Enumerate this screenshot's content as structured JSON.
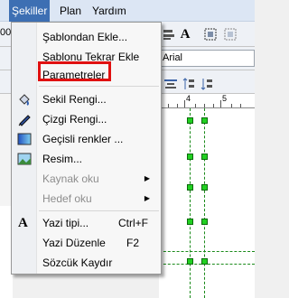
{
  "menubar": {
    "items": [
      {
        "label": "Şekiller",
        "active": true
      },
      {
        "label": "Plan"
      },
      {
        "label": "Yardım"
      }
    ]
  },
  "toolbar": {
    "partial_text": "00",
    "bold_icon": "A"
  },
  "font_box": {
    "value": "Arial"
  },
  "ruler": {
    "numbers": [
      "4",
      "5"
    ]
  },
  "menu": {
    "items": [
      {
        "label": "Şablondan Ekle...",
        "icon": null
      },
      {
        "label": "Şablonu Tekrar Ekle",
        "icon": null
      },
      {
        "label": "Parametreler",
        "icon": null,
        "highlighted": true
      },
      {
        "label": "Sekil Rengi...",
        "icon": "paint-bucket-icon"
      },
      {
        "label": "Çizgi Rengi...",
        "icon": "pen-icon"
      },
      {
        "label": "Geçisli renkler ...",
        "icon": "gradient-icon"
      },
      {
        "label": "Resim...",
        "icon": "picture-icon"
      },
      {
        "label": "Kaynak oku",
        "submenu": true,
        "disabled": true
      },
      {
        "label": "Hedef oku",
        "submenu": true,
        "disabled": true
      },
      {
        "label": "Yazi tipi...",
        "icon": "font-icon",
        "shortcut": "Ctrl+F"
      },
      {
        "label": "Yazi Düzenle",
        "shortcut": "F2"
      },
      {
        "label": "Sözcük Kaydır"
      }
    ]
  },
  "colors": {
    "menubar_active": "#3d6fb3",
    "highlight_border": "#e01010",
    "connector_green": "#21d021"
  }
}
